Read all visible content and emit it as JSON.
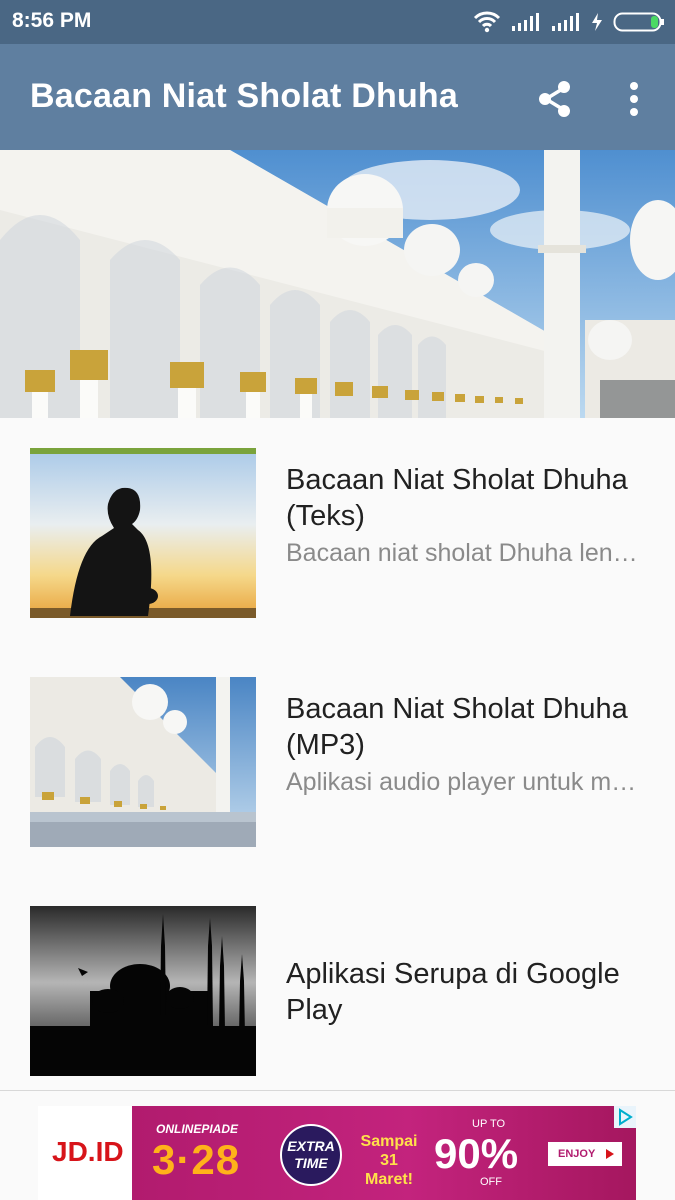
{
  "status_bar": {
    "time": "8:56 PM"
  },
  "app_bar": {
    "title": "Bacaan Niat Sholat Dhuha",
    "share_icon": "share-icon",
    "more_icon": "more-vert-icon"
  },
  "list": {
    "items": [
      {
        "title": "Bacaan Niat Sholat Dhuha (Teks)",
        "description": "Bacaan niat sholat Dhuha lengkap dengan tulisan latin …"
      },
      {
        "title": "Bacaan Niat Sholat Dhuha (MP3)",
        "description": "Aplikasi audio player untuk mendengarkan bacaan niat s…"
      },
      {
        "title": "Aplikasi Serupa di Google Play",
        "description": ""
      }
    ]
  },
  "ad": {
    "brand": "JD.ID",
    "event": "ONLINEPIADE",
    "date": "3·28",
    "badge": "EXTRA TIME",
    "until": "Sampai 31 Maret!",
    "up_to": "UP TO",
    "discount": "90%",
    "off": "OFF",
    "cta": "ENJOY"
  },
  "colors": {
    "status_bar": "#4a6784",
    "app_bar": "#5f7fa0",
    "background": "#fafafa",
    "title_text": "#212121",
    "secondary_text": "#8a8a8a"
  }
}
